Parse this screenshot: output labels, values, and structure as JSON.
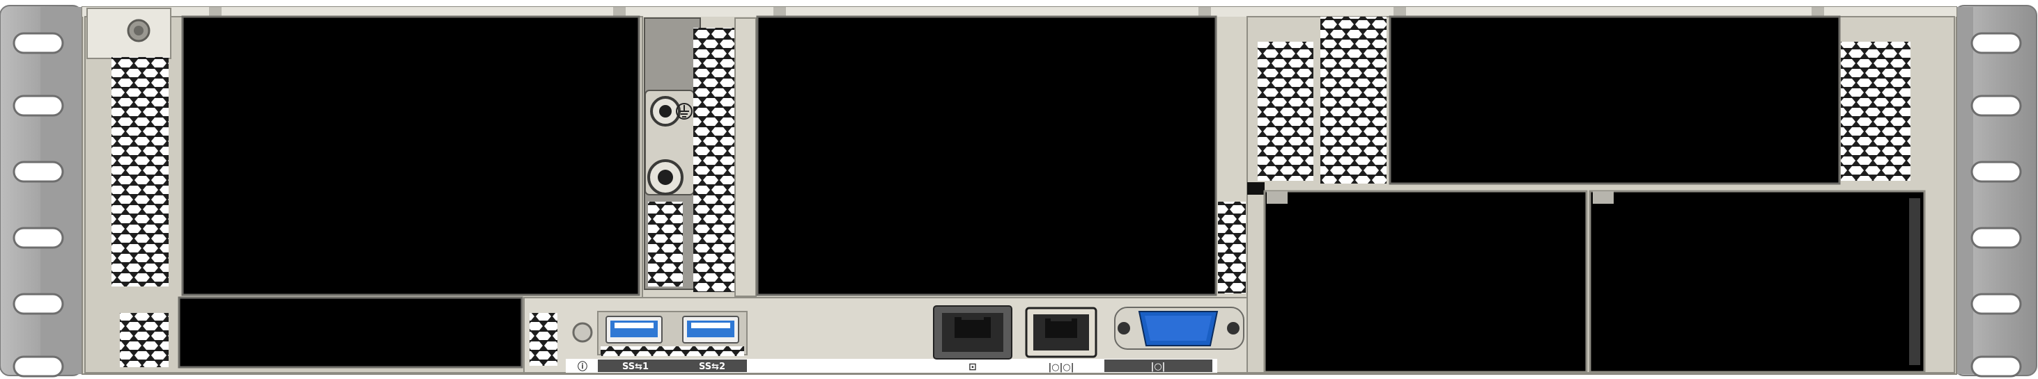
{
  "colors": {
    "rack_ear": "#a7a7a7",
    "chassis": "#d9d6cc",
    "chassis_dark": "#c4c1b6",
    "bay_fill": "#000000",
    "usb_blue": "#2f78d4",
    "vga_blue": "#1a5fc4",
    "label_bar": "#4d4d4d"
  },
  "icons": {
    "ground": "ground-symbol-icon",
    "usb": "usb-superspeed-icon",
    "mgmt": "management-port-icon",
    "serial": "serial-port-icon",
    "vga": "vga-port-icon",
    "uid": "uid-button-icon"
  },
  "ports": {
    "usb1_label": "SS⇆1",
    "usb2_label": "SS⇆2",
    "uid_symbol": "ⓘ",
    "mgmt_symbol": "⊡",
    "serial_symbol": "|○|○|",
    "vga_symbol": "|○|"
  }
}
